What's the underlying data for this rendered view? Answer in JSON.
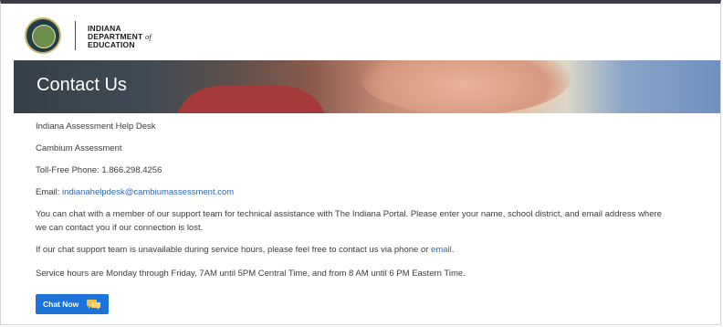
{
  "header": {
    "org_line1": "INDIANA",
    "org_line2": "DEPARTMENT",
    "org_line2_suffix": "of",
    "org_line3": "EDUCATION"
  },
  "banner": {
    "title": "Contact Us"
  },
  "contact": {
    "help_desk": "Indiana Assessment Help Desk",
    "vendor": "Cambium Assessment",
    "phone_line": "Toll-Free Phone: 1.866.298.4256",
    "email_label": "Email: ",
    "email": "indianahelpdesk@cambiumassessment.com",
    "chat_info": "You can chat with a member of our support team for technical assistance with The Indiana Portal. Please enter your name, school district, and email address where we can contact you if our connection is lost.",
    "unavailable_prefix": "If our chat support team is unavailable during service hours, please feel free to contact us via phone or ",
    "unavailable_link": "email",
    "unavailable_suffix": ".",
    "hours": "Service hours are Monday through Friday, 7AM until 5PM Central Time, and from 8 AM until 6 PM Eastern Time."
  },
  "chat_button": {
    "label": "Chat Now",
    "icon": "chat-bubbles-icon"
  },
  "colors": {
    "accent": "#1e73d8",
    "link": "#2a6ab5",
    "header_border": "#3a3a4a"
  }
}
